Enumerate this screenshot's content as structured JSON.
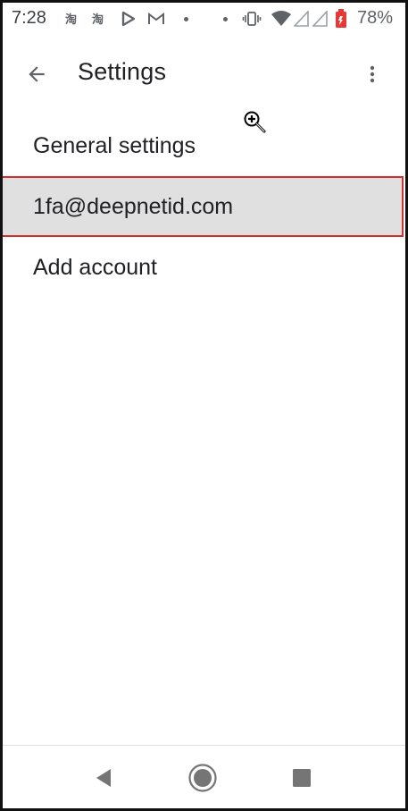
{
  "status_bar": {
    "time": "7:28",
    "battery_percent": "78%",
    "notification_icons": [
      "taobao-icon",
      "taobao-icon",
      "play-store-icon",
      "gmail-icon"
    ],
    "system_icons": [
      "vibrate-icon",
      "wifi-icon",
      "signal-icon",
      "signal-icon",
      "battery-icon"
    ],
    "battery_color": "#e53935"
  },
  "toolbar": {
    "title": "Settings",
    "back_icon": "arrow-back-icon",
    "overflow_icon": "more-vert-icon"
  },
  "settings": {
    "items": [
      {
        "label": "General settings"
      },
      {
        "label": "1fa@deepnetid.com",
        "highlighted": true
      },
      {
        "label": "Add account"
      }
    ]
  },
  "nav_bar": {
    "buttons": [
      "back-triangle-icon",
      "home-circle-icon",
      "recents-square-icon"
    ]
  },
  "colors": {
    "highlight_bg": "#e0e0e0",
    "highlight_border": "#d32f2f",
    "text_primary": "#202124",
    "icon_gray": "#5f6368"
  }
}
